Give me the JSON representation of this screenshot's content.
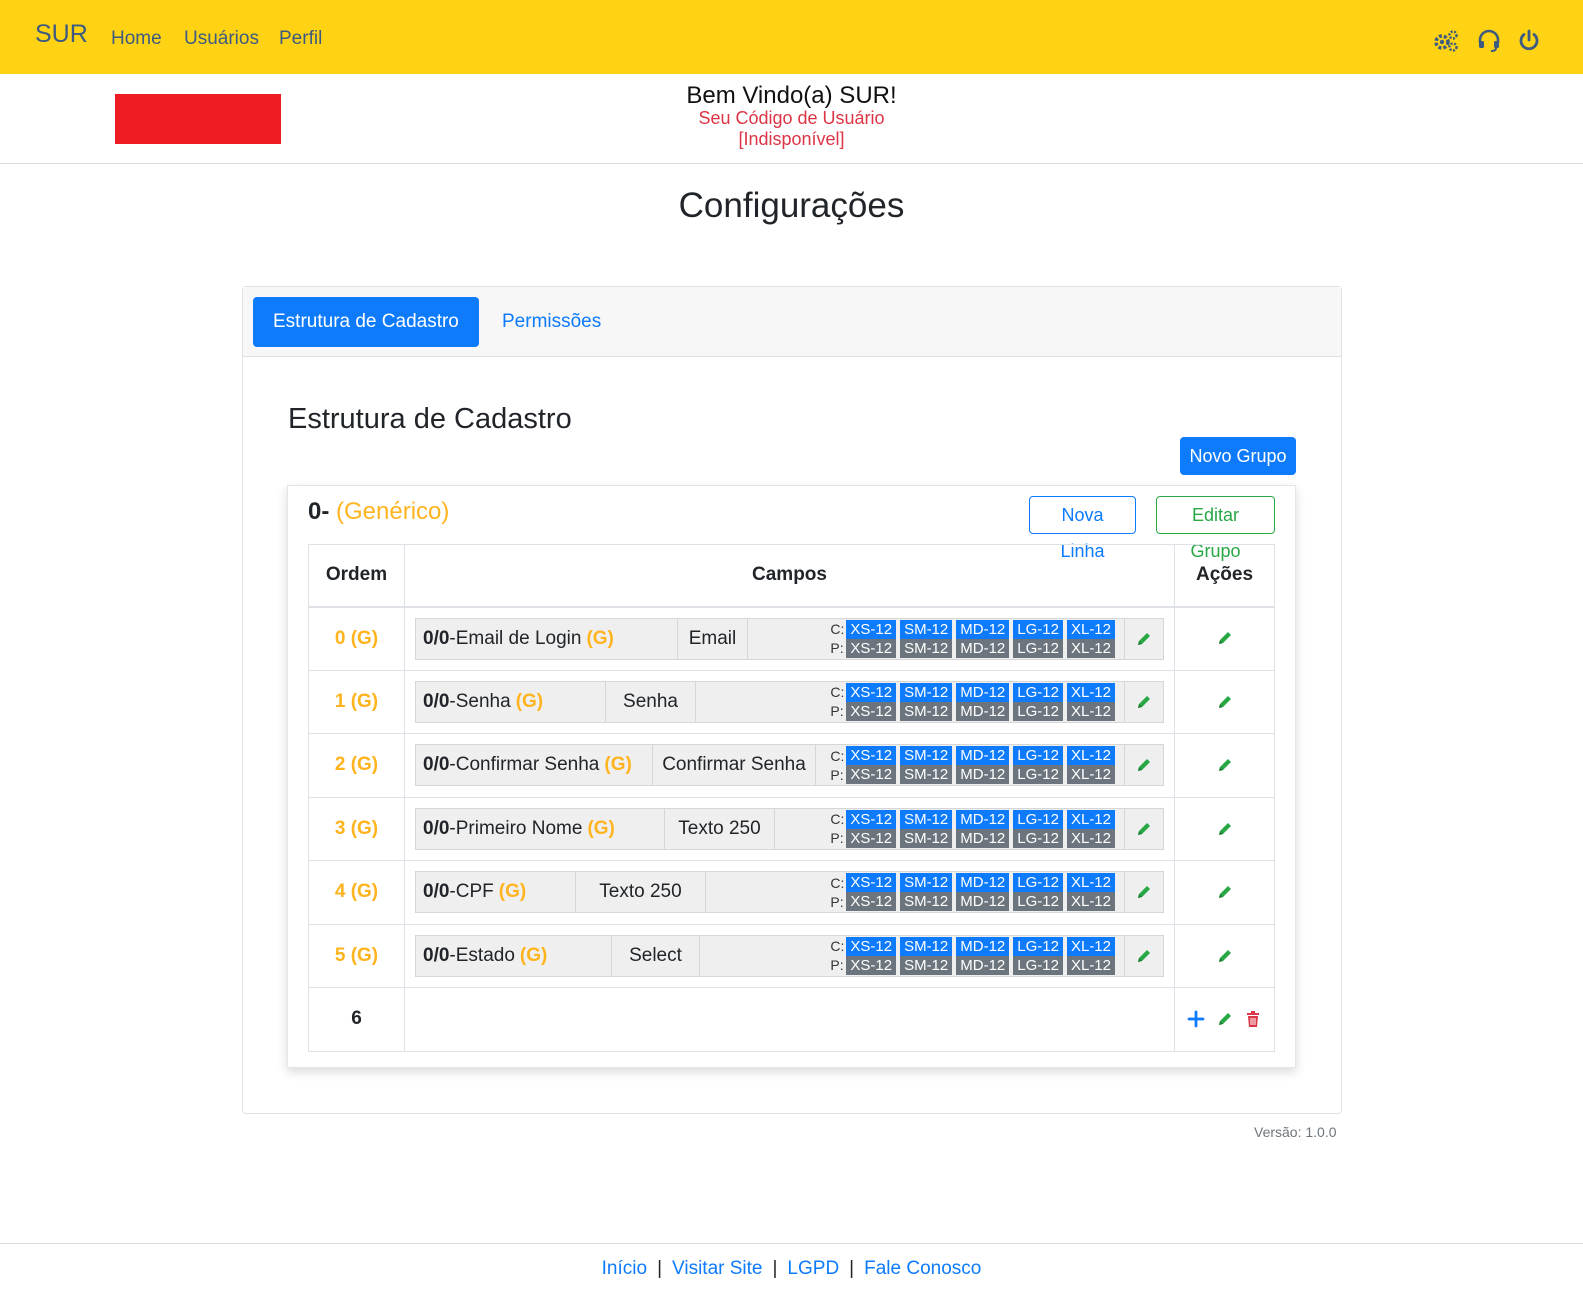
{
  "navbar": {
    "brand": "SUR",
    "links": [
      "Home",
      "Usuários",
      "Perfil"
    ],
    "icons": [
      "settings-gears-icon",
      "support-headset-icon",
      "power-icon"
    ]
  },
  "welcome": {
    "title": "Bem Vindo(a) SUR!",
    "subtitle_line1": "Seu Código de Usuário",
    "subtitle_line2": "[Indisponível]"
  },
  "page_title": "Configurações",
  "tabs": [
    {
      "label": "Estrutura de Cadastro",
      "active": true
    },
    {
      "label": "Permissões",
      "active": false
    }
  ],
  "section": {
    "title": "Estrutura de Cadastro",
    "new_group_button": "Novo Grupo"
  },
  "group": {
    "number": "0-",
    "name": "(Genérico)",
    "new_line_button": "Nova Linha",
    "edit_group_button": "Editar Grupo",
    "columns": [
      "Ordem",
      "Campos",
      "Ações"
    ],
    "rows": [
      {
        "ordem": "0 (G)",
        "field": {
          "prefix": "0/0",
          "name": "-Email de Login",
          "flag": "(G)",
          "type": "Email"
        }
      },
      {
        "ordem": "1 (G)",
        "field": {
          "prefix": "0/0",
          "name": "-Senha",
          "flag": "(G)",
          "type": "Senha"
        }
      },
      {
        "ordem": "2 (G)",
        "field": {
          "prefix": "0/0",
          "name": "-Confirmar Senha",
          "flag": "(G)",
          "type": "Confirmar Senha"
        }
      },
      {
        "ordem": "3 (G)",
        "field": {
          "prefix": "0/0",
          "name": "-Primeiro Nome",
          "flag": "(G)",
          "type": "Texto 250"
        }
      },
      {
        "ordem": "4 (G)",
        "field": {
          "prefix": "0/0",
          "name": "-CPF",
          "flag": "(G)",
          "type": "Texto 250"
        }
      },
      {
        "ordem": "5 (G)",
        "field": {
          "prefix": "0/0",
          "name": "-Estado",
          "flag": "(G)",
          "type": "Select"
        }
      }
    ],
    "last_row_ordem": "6",
    "size_labels": {
      "c": "C:",
      "p": "P:"
    },
    "sizes": [
      "XS-12",
      "SM-12",
      "MD-12",
      "LG-12",
      "XL-12"
    ]
  },
  "version": "Versão: 1.0.0",
  "footer": {
    "links": [
      "Início",
      "Visitar Site",
      "LGPD",
      "Fale Conosco"
    ],
    "separator": "|"
  },
  "colors": {
    "navbar": "#ffd314",
    "primary": "#0d7bfb",
    "success": "#28a745",
    "danger": "#dc3545",
    "accent": "#ffb41f",
    "badge_gray": "#6c757d"
  }
}
